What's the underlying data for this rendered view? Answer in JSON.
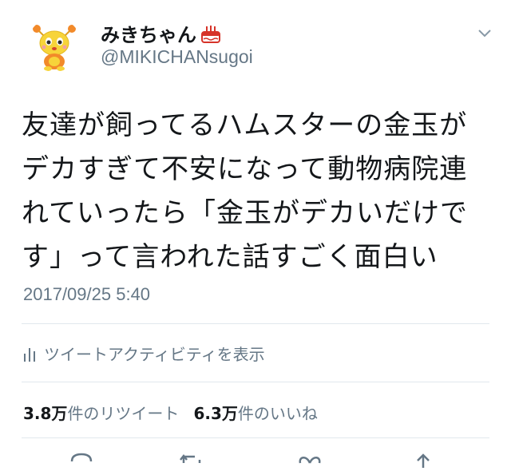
{
  "user": {
    "display_name": "みきちゃん",
    "handle": "@MIKICHANsugoi"
  },
  "tweet": {
    "text": "友達が飼ってるハムスターの金玉が\nデカすぎて不安になって動物病院連\nれていったら「金玉がデカいだけで\nす」って言われた話すごく面白い",
    "timestamp": "2017/09/25 5:40"
  },
  "activity": {
    "label": "ツイートアクティビティを表示",
    "icon": "bar-chart-icon"
  },
  "stats": {
    "retweets_count": "3.8万",
    "retweets_label": "件のリツイート",
    "likes_count": "6.3万",
    "likes_label": "件のいいね"
  },
  "icons": {
    "menu": "chevron-down-icon",
    "reply": "reply-icon",
    "retweet": "retweet-icon",
    "like": "heart-icon",
    "share": "share-icon"
  },
  "colors": {
    "text": "#14171a",
    "secondary": "#657786",
    "divider": "#e1e8ed",
    "avatar_yellow": "#f7d43a",
    "avatar_orange": "#f28a2a"
  }
}
